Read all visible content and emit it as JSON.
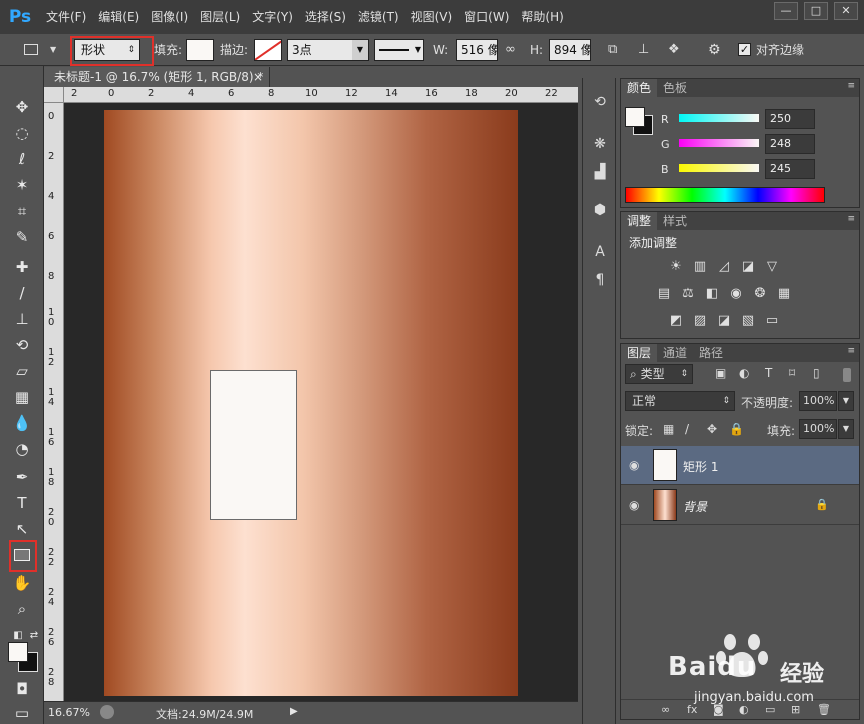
{
  "app": {
    "logo": "Ps"
  },
  "menu": [
    "文件(F)",
    "编辑(E)",
    "图像(I)",
    "图层(L)",
    "文字(Y)",
    "选择(S)",
    "滤镜(T)",
    "视图(V)",
    "窗口(W)",
    "帮助(H)"
  ],
  "window_controls": {
    "minimize": "—",
    "maximize": "□",
    "close": "✕"
  },
  "options": {
    "mode": "形状",
    "fill_label": "填充:",
    "stroke_label": "描边:",
    "stroke_size": "3点",
    "w_label": "W:",
    "w_value": "516 像",
    "h_label": "H:",
    "h_value": "894 像",
    "align_label": "对齐边缘",
    "align_checked": true
  },
  "document": {
    "tab_title": "未标题-1 @ 16.7% (矩形 1, RGB/8) *",
    "tab_close": "×",
    "ruler_h": [
      "2",
      "0",
      "2",
      "4",
      "6",
      "8",
      "10",
      "12",
      "14",
      "16",
      "18",
      "20",
      "22"
    ],
    "ruler_v": [
      "0",
      "2",
      "4",
      "6",
      "8",
      "1 0",
      "1 2",
      "1 4",
      "1 6",
      "1 8",
      "2 0",
      "2 2",
      "2 4",
      "2 6",
      "2 8"
    ],
    "gradient_colors": [
      "#a04a22",
      "#fde0d0",
      "#8a3b1c"
    ]
  },
  "status": {
    "zoom": "16.67%",
    "doc_info": "文档:24.9M/24.9M",
    "arrow": "▶"
  },
  "color_panel": {
    "tabs": [
      "颜色",
      "色板"
    ],
    "r_label": "R",
    "r_value": "250",
    "g_label": "G",
    "g_value": "248",
    "b_label": "B",
    "b_value": "245",
    "fg_color": "#faf8f5"
  },
  "adjust_panel": {
    "tabs": [
      "调整",
      "样式"
    ],
    "title": "添加调整",
    "icons": [
      "brightness-icon",
      "levels-icon",
      "curves-icon",
      "exposure-icon",
      "vibrance-icon",
      "hue-icon",
      "balance-icon",
      "bw-icon",
      "photo-filter-icon",
      "channel-mixer-icon",
      "lookup-icon",
      "invert-icon",
      "posterize-icon",
      "threshold-icon",
      "selective-color-icon",
      "gradient-map-icon"
    ]
  },
  "layers_panel": {
    "tabs": [
      "图层",
      "通道",
      "路径"
    ],
    "filter_type": "类型",
    "blend_mode": "正常",
    "opacity_label": "不透明度:",
    "opacity_value": "100%",
    "lock_label": "锁定:",
    "fill_label": "填充:",
    "fill_value": "100%",
    "layers": [
      {
        "name": "矩形 1",
        "selected": true
      },
      {
        "name": "背景",
        "selected": false,
        "locked": true
      }
    ]
  },
  "watermark": {
    "brand": "Baidu",
    "brand_cn": "经验",
    "url": "jingyan.baidu.com"
  }
}
